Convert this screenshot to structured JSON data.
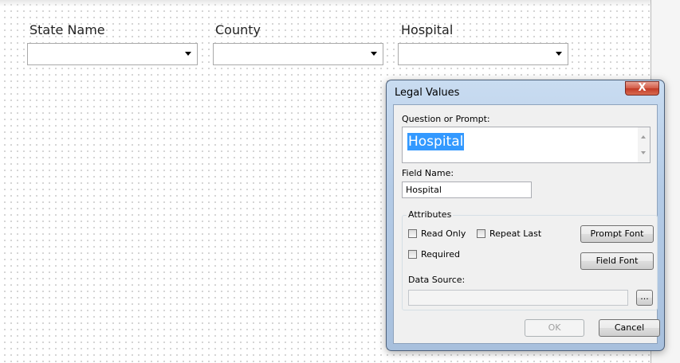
{
  "form": {
    "fields": [
      {
        "label": "State Name",
        "value": ""
      },
      {
        "label": "County",
        "value": ""
      },
      {
        "label": "Hospital",
        "value": ""
      }
    ]
  },
  "dialog": {
    "title": "Legal Values",
    "close_label": "X",
    "question_label": "Question or Prompt:",
    "question_value": "Hospital",
    "field_name_label": "Field Name:",
    "field_name_value": "Hospital",
    "attributes_label": "Attributes",
    "read_only_label": "Read Only",
    "read_only_checked": false,
    "repeat_last_label": "Repeat Last",
    "repeat_last_checked": false,
    "required_label": "Required",
    "required_checked": false,
    "prompt_font_label": "Prompt Font",
    "field_font_label": "Field Font",
    "data_source_label": "Data Source:",
    "data_source_value": "",
    "browse_label": "...",
    "ok_label": "OK",
    "ok_enabled": false,
    "cancel_label": "Cancel"
  },
  "colors": {
    "title_bar": "#b4cbe6",
    "close_button": "#c13a26",
    "selection": "#3399ff"
  }
}
